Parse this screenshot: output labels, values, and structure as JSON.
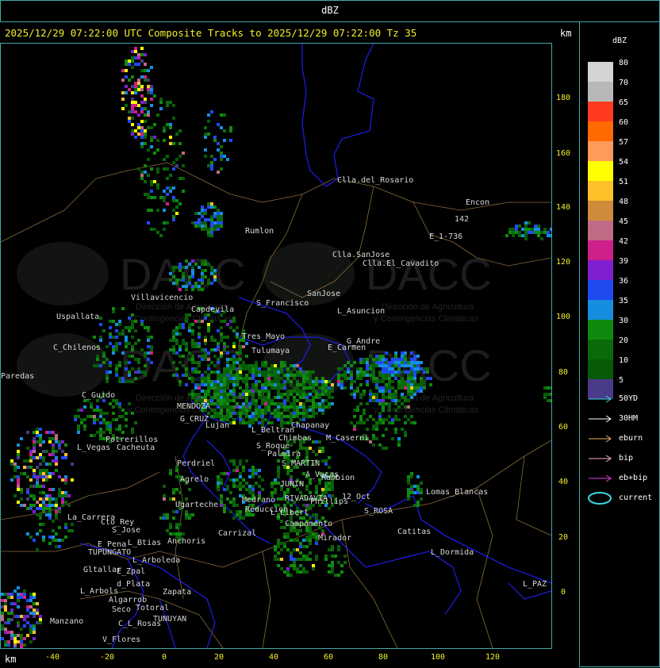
{
  "window": {
    "title": "dBZ"
  },
  "header": {
    "text": "2025/12/29 07:22:00 UTC Composite Tracks to 2025/12/29 07:22:00 Tz 35",
    "km_top": "km",
    "km_bottom": "km"
  },
  "axes": {
    "y_ticks": [
      "180",
      "160",
      "140",
      "120",
      "100",
      "80",
      "60",
      "40",
      "20",
      "0"
    ],
    "x_ticks": [
      "-40",
      "-20",
      "0",
      "20",
      "40",
      "60",
      "80",
      "100",
      "120"
    ]
  },
  "legend": {
    "title": "dBZ",
    "scale": [
      {
        "label": "80",
        "color": "#d4d4d4"
      },
      {
        "label": "70",
        "color": "#b8b8b8"
      },
      {
        "label": "65",
        "color": "#ff3a1f"
      },
      {
        "label": "60",
        "color": "#ff6a00"
      },
      {
        "label": "57",
        "color": "#ff9a5a"
      },
      {
        "label": "54",
        "color": "#ffff00"
      },
      {
        "label": "51",
        "color": "#fcc128"
      },
      {
        "label": "48",
        "color": "#cf8a3a"
      },
      {
        "label": "45",
        "color": "#c06a86"
      },
      {
        "label": "42",
        "color": "#cf1f8a"
      },
      {
        "label": "39",
        "color": "#7f1fcf"
      },
      {
        "label": "36",
        "color": "#1f4af0"
      },
      {
        "label": "35",
        "color": "#168ee0"
      },
      {
        "label": "30",
        "color": "#0f8a0f"
      },
      {
        "label": "20",
        "color": "#0a6a0a"
      },
      {
        "label": "10",
        "color": "#085a08"
      },
      {
        "label": "5",
        "color": "#4a3a8a"
      }
    ],
    "tracks": [
      {
        "label": "50YD",
        "color": "#3fd6e0",
        "icon": "arrow-right-icon"
      },
      {
        "label": "30HM",
        "color": "#ffffff",
        "icon": "arrow-right-icon"
      },
      {
        "label": "eburn",
        "color": "#e8b060",
        "icon": "arrow-right-icon"
      },
      {
        "label": "bip",
        "color": "#f0b0d0",
        "icon": "arrow-right-icon"
      },
      {
        "label": "eb+bip",
        "color": "#e040e0",
        "icon": "arrow-right-icon"
      },
      {
        "label": "current",
        "color": "#3fd6e0",
        "icon": "ellipse-icon"
      }
    ]
  },
  "watermark": {
    "text": "DACC",
    "subtitle1": "Dirección de Agricultura",
    "subtitle2": "y Contingencias Climáticas"
  },
  "places": [
    {
      "name": "Clla.del_Rosario"
    },
    {
      "name": "Encon"
    },
    {
      "name": "142"
    },
    {
      "name": "E_1-736"
    },
    {
      "name": "Rumlon"
    },
    {
      "name": "Clla.SanJose"
    },
    {
      "name": "Clla.El_Cavadito"
    },
    {
      "name": "Villavicencio"
    },
    {
      "name": "Uspallata"
    },
    {
      "name": "Capdevila"
    },
    {
      "name": "S_Francisco"
    },
    {
      "name": "SanJose"
    },
    {
      "name": "L_Asuncion"
    },
    {
      "name": "C_Chilenos"
    },
    {
      "name": "Tres_Mayo"
    },
    {
      "name": "E_Carmen"
    },
    {
      "name": "G_Andre"
    },
    {
      "name": "Tulumaya"
    },
    {
      "name": "Paredas"
    },
    {
      "name": "C_Guido"
    },
    {
      "name": "MENDOZA"
    },
    {
      "name": "G_CRUZ"
    },
    {
      "name": "Lujan"
    },
    {
      "name": "Potrerillos"
    },
    {
      "name": "L_Vegas"
    },
    {
      "name": "Cacheuta"
    },
    {
      "name": "Perdriel"
    },
    {
      "name": "Agrelo"
    },
    {
      "name": "Ugarteche"
    },
    {
      "name": "L_Beltran"
    },
    {
      "name": "Chimbas"
    },
    {
      "name": "Chapanay"
    },
    {
      "name": "M_Caserni"
    },
    {
      "name": "Palmira"
    },
    {
      "name": "S_Roque"
    },
    {
      "name": "S_MARTIN"
    },
    {
      "name": "A_Vacas"
    },
    {
      "name": "Rambion"
    },
    {
      "name": "JUNIN"
    },
    {
      "name": "RIVADAVIA"
    },
    {
      "name": "Phillips"
    },
    {
      "name": "12_Oct"
    },
    {
      "name": "S_ROSA"
    },
    {
      "name": "Lomas_Blancas"
    },
    {
      "name": "Medrano"
    },
    {
      "name": "Reduccion"
    },
    {
      "name": "L_Libert"
    },
    {
      "name": "Campamento"
    },
    {
      "name": "Catitas"
    },
    {
      "name": "La_Carrera"
    },
    {
      "name": "Cto_Rey"
    },
    {
      "name": "S_Jose"
    },
    {
      "name": "Carrizal"
    },
    {
      "name": "Anchoris"
    },
    {
      "name": "E_Pena"
    },
    {
      "name": "TUPUNGATO"
    },
    {
      "name": "L_Btias"
    },
    {
      "name": "L_Arboleda"
    },
    {
      "name": "Mirador"
    },
    {
      "name": "L_Dormida"
    },
    {
      "name": "Gltallar"
    },
    {
      "name": "E_Zpal"
    },
    {
      "name": "L_Arbols"
    },
    {
      "name": "d_Plata"
    },
    {
      "name": "Zapata"
    },
    {
      "name": "Algarrob"
    },
    {
      "name": "Seco"
    },
    {
      "name": "Totoral"
    },
    {
      "name": "TUNUYAN"
    },
    {
      "name": "C_L_Rosas"
    },
    {
      "name": "Manzano"
    },
    {
      "name": "V_Flores"
    },
    {
      "name": "L_PAZ"
    },
    {
      "name": "Ramblon"
    }
  ]
}
